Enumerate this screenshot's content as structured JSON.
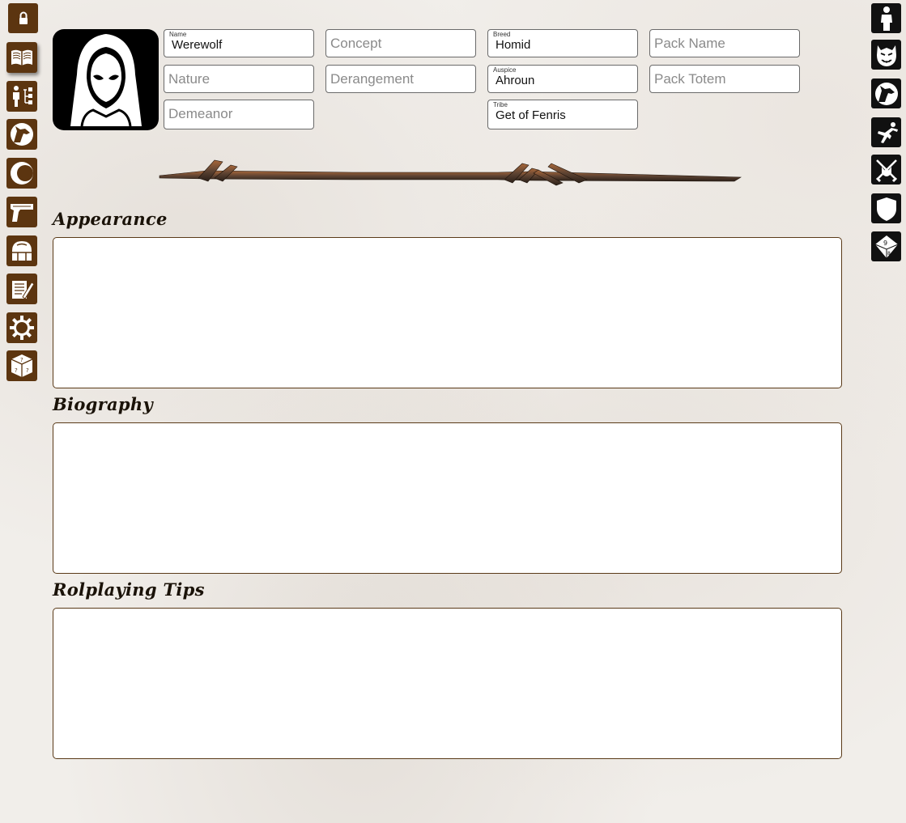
{
  "left_nav": [
    {
      "icon": "lock-icon",
      "name": "lock-button"
    },
    {
      "icon": "book-icon",
      "name": "nav-book"
    },
    {
      "icon": "character-tree-icon",
      "name": "nav-character-tree"
    },
    {
      "icon": "wolf-head-icon",
      "name": "nav-werewolf"
    },
    {
      "icon": "moon-icon",
      "name": "nav-moon"
    },
    {
      "icon": "pistol-icon",
      "name": "nav-weapons"
    },
    {
      "icon": "backpack-icon",
      "name": "nav-equipment"
    },
    {
      "icon": "notes-icon",
      "name": "nav-notes"
    },
    {
      "icon": "gear-icon",
      "name": "nav-settings"
    },
    {
      "icon": "dice-icon",
      "name": "nav-dice"
    }
  ],
  "right_nav": [
    {
      "icon": "human-silhouette-icon",
      "name": "form-homid"
    },
    {
      "icon": "glabro-face-icon",
      "name": "form-glabro"
    },
    {
      "icon": "wolf-head-icon",
      "name": "form-lupus"
    },
    {
      "icon": "leaping-figure-icon",
      "name": "form-action"
    },
    {
      "icon": "crossed-swords-icon",
      "name": "form-combat"
    },
    {
      "icon": "shield-icon",
      "name": "form-defense"
    },
    {
      "icon": "d10-die-icon",
      "name": "form-roll"
    }
  ],
  "fields": {
    "name": {
      "label": "Name",
      "value": "Werewolf"
    },
    "concept": {
      "placeholder": "Concept"
    },
    "breed": {
      "label": "Breed",
      "value": "Homid"
    },
    "pack_name": {
      "placeholder": "Pack Name"
    },
    "nature": {
      "placeholder": "Nature"
    },
    "derangement": {
      "placeholder": "Derangement"
    },
    "auspice": {
      "label": "Auspice",
      "value": "Ahroun"
    },
    "pack_totem": {
      "placeholder": "Pack Totem"
    },
    "demeanor": {
      "placeholder": "Demeanor"
    },
    "tribe": {
      "label": "Tribe",
      "value": "Get of Fenris"
    }
  },
  "sections": {
    "appearance": "Appearance",
    "biography": "Biography",
    "roleplaying": "Rolplaying Tips"
  },
  "colors": {
    "nav_brown": "#5c3510",
    "right_nav_black": "#111111",
    "textarea_border": "#5a3a18"
  }
}
